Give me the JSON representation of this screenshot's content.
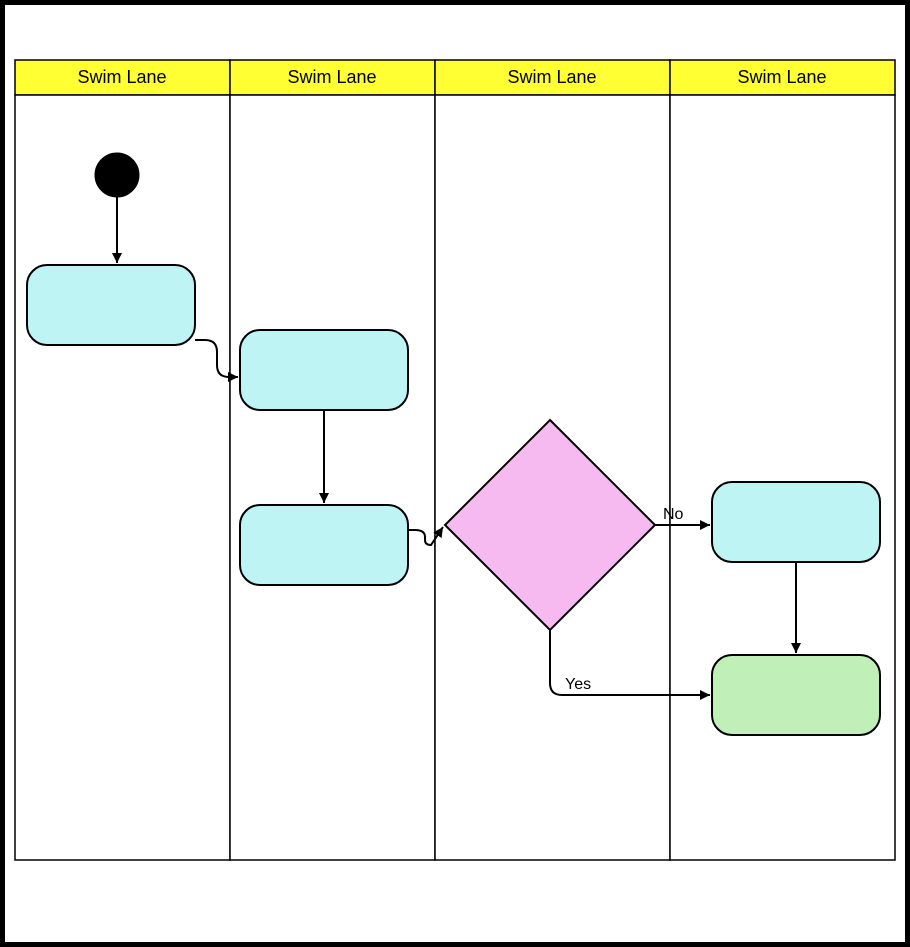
{
  "lanes": [
    {
      "label": "Swim Lane"
    },
    {
      "label": "Swim Lane"
    },
    {
      "label": "Swim Lane"
    },
    {
      "label": "Swim Lane"
    }
  ],
  "edges": {
    "no_label": "No",
    "yes_label": "Yes"
  }
}
